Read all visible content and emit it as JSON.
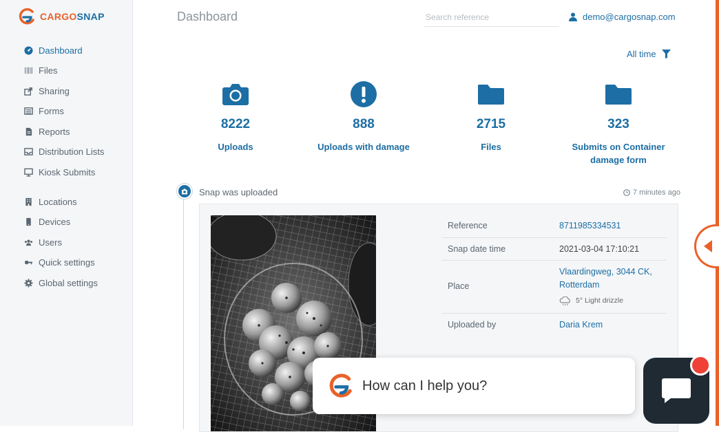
{
  "brand": {
    "part1": "CARGO",
    "part2": "SNAP"
  },
  "colors": {
    "primary": "#1c6ea4",
    "accent": "#e8622a",
    "sidebar_bg": "#f4f6f8",
    "chat_dark": "#1f2a33",
    "badge": "#ef4136"
  },
  "sidebar": {
    "items": [
      {
        "label": "Dashboard",
        "icon": "dashboard-icon",
        "active": true
      },
      {
        "label": "Files",
        "icon": "barcode-icon"
      },
      {
        "label": "Sharing",
        "icon": "share-icon"
      },
      {
        "label": "Forms",
        "icon": "list-icon"
      },
      {
        "label": "Reports",
        "icon": "file-icon"
      },
      {
        "label": "Distribution Lists",
        "icon": "inbox-icon"
      },
      {
        "label": "Kiosk Submits",
        "icon": "monitor-icon"
      },
      {
        "label": "Locations",
        "icon": "building-icon"
      },
      {
        "label": "Devices",
        "icon": "mobile-icon"
      },
      {
        "label": "Users",
        "icon": "users-icon"
      },
      {
        "label": "Quick settings",
        "icon": "key-icon"
      },
      {
        "label": "Global settings",
        "icon": "gear-icon"
      }
    ]
  },
  "header": {
    "title": "Dashboard",
    "search_placeholder": "Search reference",
    "user_email": "demo@cargosnap.com"
  },
  "filter": {
    "label": "All time"
  },
  "stats": [
    {
      "value": "8222",
      "label": "Uploads",
      "icon": "camera-icon"
    },
    {
      "value": "888",
      "label": "Uploads with damage",
      "icon": "exclamation-icon"
    },
    {
      "value": "2715",
      "label": "Files",
      "icon": "folder-icon"
    },
    {
      "value": "323",
      "label": "Submits on Container damage form",
      "icon": "folder-icon"
    }
  ],
  "event": {
    "title": "Snap was uploaded",
    "time": "7 minutes ago",
    "details": {
      "reference_label": "Reference",
      "reference_value": "8711985334531",
      "datetime_label": "Snap date time",
      "datetime_value": "2021-03-04 17:10:21",
      "place_label": "Place",
      "place_value": "Vlaardingweg, 3044 CK, Rotterdam",
      "weather": "5° Light drizzle",
      "uploaded_label": "Uploaded by",
      "uploaded_value": "Daria Krem"
    }
  },
  "chat": {
    "prompt": "How can I help you?"
  }
}
